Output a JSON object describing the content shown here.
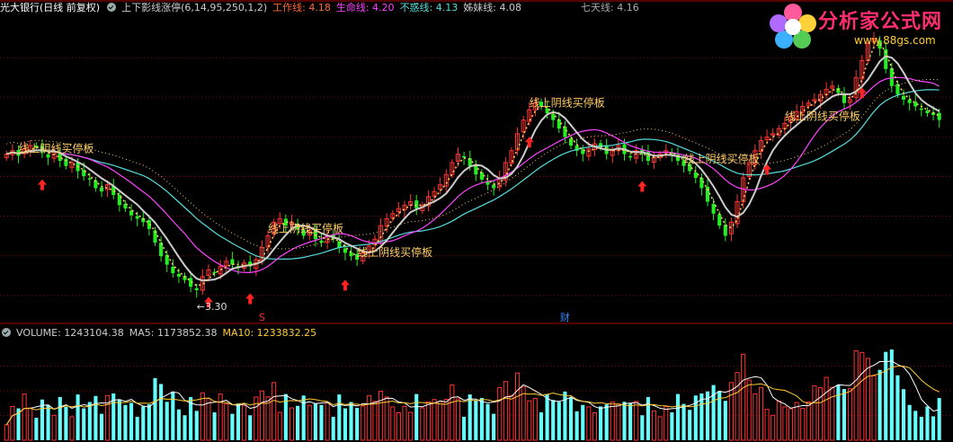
{
  "header": {
    "stock": "光大银行(日线 前复权)",
    "indicator": "上下影线涨停(6,14,95,250,1,2)",
    "lines": [
      {
        "label": "工作线: 4.18",
        "color": "#ff6a3a"
      },
      {
        "label": "生命线: 4.20",
        "color": "#ff44ff"
      },
      {
        "label": "不惑线: 4.13",
        "color": "#55dddd"
      },
      {
        "label": "姊妹线: 4.08",
        "color": "#cccccc"
      }
    ],
    "seven_day": "七天线: 4.16"
  },
  "volume_header": {
    "volume": "VOLUME: 1243104.38",
    "ma5": "MA5: 1173852.38",
    "ma10": "MA10: 1233832.25"
  },
  "logo": {
    "title": "分析家公式网",
    "url": "www.88gs.com"
  },
  "colors": {
    "up": "#ff3333",
    "down": "#22ee22",
    "vol_up": "#ff3333",
    "vol_down": "#66ffff",
    "work": "#ffcc66",
    "life": "#ff44ff",
    "buhuo": "#55dddd",
    "sister": "#cccccc",
    "grid": "#8b0000",
    "annot": "#ffcc66",
    "arrow": "#ff2222"
  },
  "chart_data": {
    "type": "candlestick",
    "y_range": [
      3.2,
      4.9
    ],
    "close": [
      4.1,
      4.12,
      4.09,
      4.13,
      4.15,
      4.14,
      4.11,
      4.08,
      4.1,
      4.06,
      4.03,
      4.05,
      4.0,
      3.97,
      3.95,
      3.9,
      3.88,
      3.92,
      3.86,
      3.8,
      3.78,
      3.74,
      3.72,
      3.7,
      3.66,
      3.58,
      3.5,
      3.45,
      3.4,
      3.38,
      3.36,
      3.32,
      3.3,
      3.38,
      3.42,
      3.4,
      3.44,
      3.47,
      3.45,
      3.43,
      3.46,
      3.44,
      3.48,
      3.55,
      3.62,
      3.7,
      3.72,
      3.68,
      3.7,
      3.66,
      3.62,
      3.65,
      3.6,
      3.58,
      3.62,
      3.6,
      3.55,
      3.52,
      3.5,
      3.48,
      3.52,
      3.56,
      3.6,
      3.68,
      3.72,
      3.75,
      3.78,
      3.8,
      3.82,
      3.78,
      3.8,
      3.85,
      3.88,
      3.92,
      3.98,
      4.05,
      4.1,
      4.08,
      4.03,
      3.98,
      3.95,
      3.92,
      3.9,
      3.96,
      4.05,
      4.12,
      4.22,
      4.3,
      4.36,
      4.4,
      4.38,
      4.34,
      4.3,
      4.25,
      4.2,
      4.15,
      4.12,
      4.1,
      4.13,
      4.16,
      4.14,
      4.1,
      4.12,
      4.15,
      4.1,
      4.08,
      4.12,
      4.1,
      4.06,
      4.08,
      4.1,
      4.12,
      4.1,
      4.06,
      4.03,
      4.0,
      3.96,
      3.9,
      3.82,
      3.75,
      3.68,
      3.62,
      3.7,
      3.82,
      3.96,
      4.05,
      4.12,
      4.18,
      4.2,
      4.22,
      4.25,
      4.28,
      4.32,
      4.35,
      4.38,
      4.4,
      4.42,
      4.45,
      4.48,
      4.5,
      4.46,
      4.4,
      4.42,
      4.55,
      4.65,
      4.75,
      4.78,
      4.72,
      4.6,
      4.5,
      4.45,
      4.42,
      4.4,
      4.38,
      4.36,
      4.34,
      4.33,
      4.3
    ],
    "buy_arrows": [
      6,
      34,
      41,
      57,
      88,
      107,
      128,
      144
    ],
    "low_label": {
      "index": 32,
      "text": "←3.30"
    },
    "annotations": [
      {
        "index": 2,
        "text": "线上阴线买停板"
      },
      {
        "index": 44,
        "text": "线上阴线买停板"
      },
      {
        "index": 59,
        "text": "线上阴线买停板"
      },
      {
        "index": 88,
        "text": "线上阴线买停板"
      },
      {
        "index": 114,
        "text": "线上阴线买停板"
      },
      {
        "index": 131,
        "text": "线上阴线买停板"
      }
    ],
    "markers": [
      {
        "index": 43,
        "text": "S",
        "color": "#ff3333"
      },
      {
        "index": 94,
        "text": "财",
        "color": "#3388ff"
      }
    ]
  }
}
